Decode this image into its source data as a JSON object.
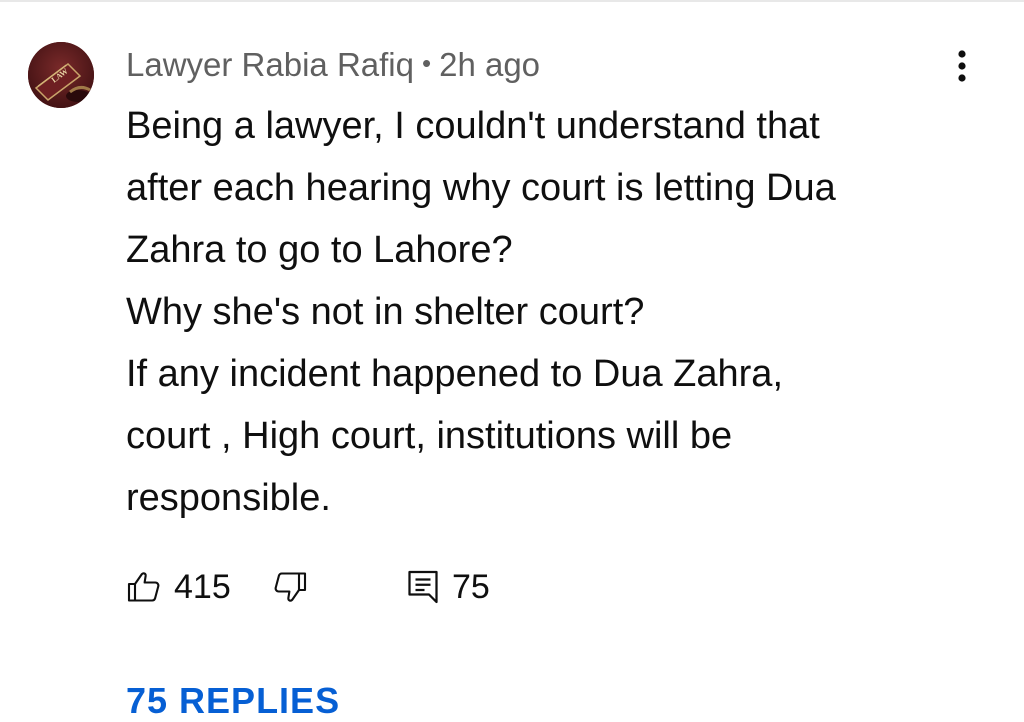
{
  "comment": {
    "author": "Lawyer Rabia Rafiq",
    "separator": "•",
    "timestamp": "2h ago",
    "avatar_label": "LAW",
    "lines": [
      "Being a lawyer, I couldn't understand that",
      "after each hearing why court is letting Dua",
      "Zahra to go to Lahore?",
      "Why she's not in shelter court?",
      "If any incident happened to Dua Zahra,",
      "court , High court, institutions will be",
      "responsible."
    ],
    "likes": "415",
    "replies_count": "75",
    "replies_link": "75 REPLIES"
  },
  "icons": {
    "menu": "more-vertical-icon",
    "like": "thumbs-up-icon",
    "dislike": "thumbs-down-icon",
    "reply": "comment-icon"
  },
  "colors": {
    "text": "#0f0f0f",
    "secondary_text": "#606060",
    "link": "#065fd4",
    "avatar_bg": "#5a1a1c"
  }
}
